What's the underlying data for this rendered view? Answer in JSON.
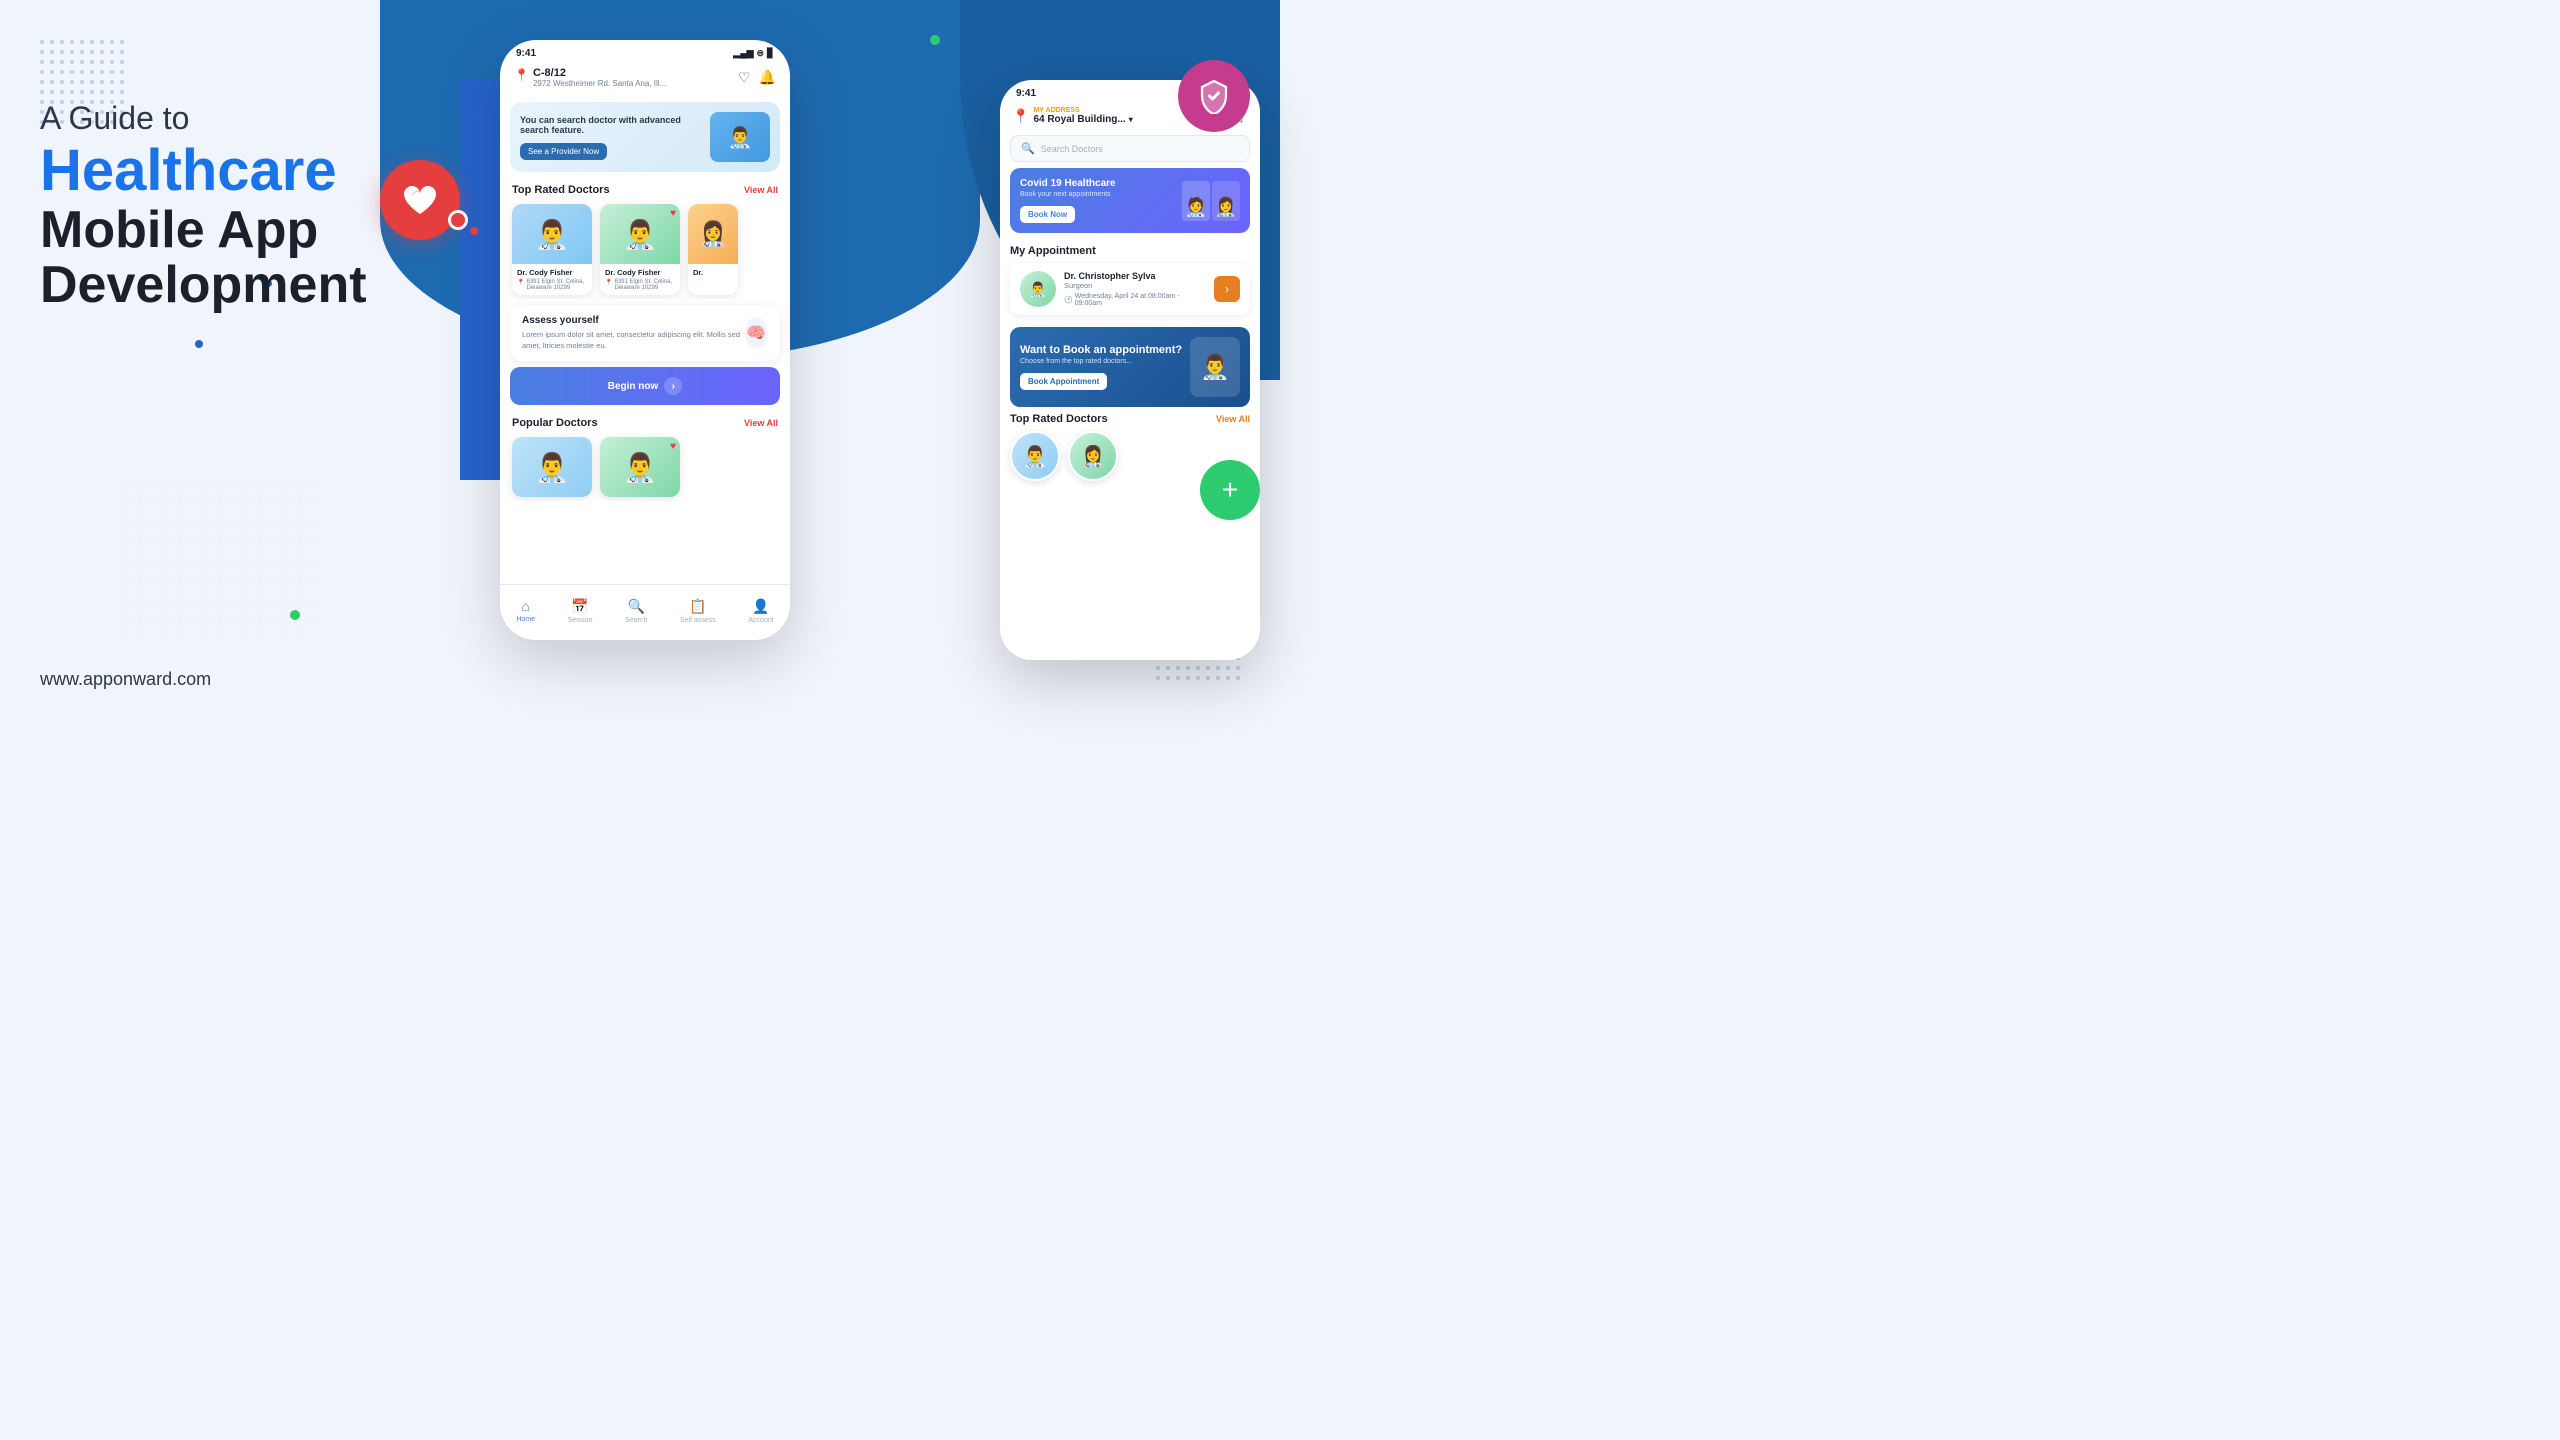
{
  "page": {
    "title": "A Guide to Healthcare Mobile App Development",
    "subtitle_line1": "A Guide to",
    "subtitle_healthcare": "Healthcare",
    "subtitle_line2": "Mobile App",
    "subtitle_line3": "Development",
    "website": "www.apponward.com"
  },
  "phone1": {
    "status_time": "9:41",
    "address_main": "C-8/12",
    "address_sub": "2972 Westheimer Rd. Santa Ana, Ill...",
    "banner_text": "You can search doctor with advanced search feature.",
    "banner_button": "See a Provider Now",
    "top_rated_title": "Top Rated Doctors",
    "top_rated_view_all": "View All",
    "doctors": [
      {
        "name": "Dr. Cody Fisher",
        "address": "6391 Elgin St. Celina, Delaware 10299"
      },
      {
        "name": "Dr. Cody Fisher",
        "address": "6391 Elgin St. Celina, Delaware 10299"
      },
      {
        "name": "Dr.",
        "address": ""
      }
    ],
    "assess_title": "Assess yourself",
    "assess_desc": "Lorem ipsum dolor sit amet, consectetur adipiscing elit. Mollis sed amet, ltricies molestie eu.",
    "begin_btn": "Begin now",
    "popular_title": "Popular Doctors",
    "popular_view_all": "View All",
    "nav": {
      "home": "Home",
      "session": "Session",
      "search": "Search",
      "self_assess": "Self assess",
      "account": "Account"
    }
  },
  "phone2": {
    "status_time": "9:41",
    "my_address_label": "MY ADDRESS",
    "address": "64 Royal Building...",
    "search_placeholder": "Search Doctors",
    "covid_title": "Covid 19 Healthcare",
    "covid_sub": "Book your next appointments",
    "covid_btn": "Book Now",
    "appointment_title": "My Appointment",
    "doctor_name": "Dr. Christopher Sylva",
    "doctor_role": "Surgeon",
    "appointment_time": "Wednesday, April 24 at 08:00am - 09:00am",
    "book_appt_title": "Want to Book an appointment?",
    "book_appt_sub": "Choose from the top rated doctors...",
    "book_appt_btn": "Book Appointment",
    "top_rated_title": "Top Rated Doctors",
    "top_rated_view_all": "View All"
  },
  "decorations": {
    "green_accent": "#2ecc71",
    "blue_accent": "#1a5fa0",
    "red_accent": "#e53e3e",
    "purple_accent": "#c53b8e",
    "orange_accent": "#e67e22"
  }
}
